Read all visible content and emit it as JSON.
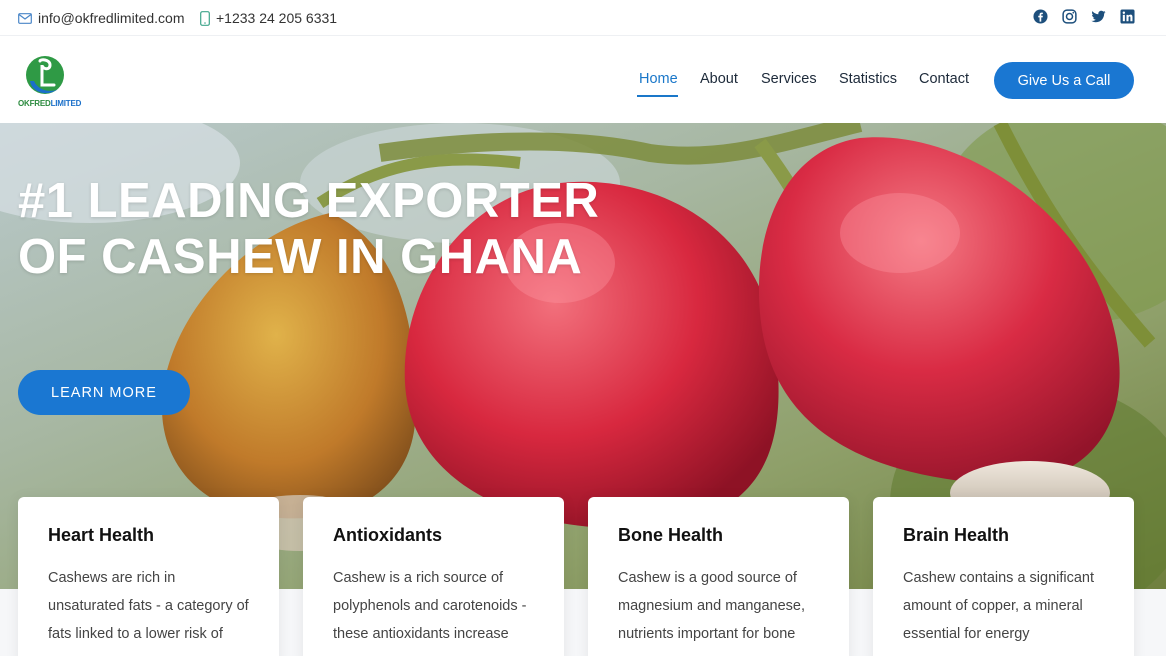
{
  "topbar": {
    "email": "info@okfredlimited.com",
    "phone": "+1233 24 205 6331",
    "socials": [
      "facebook-icon",
      "instagram-icon",
      "twitter-icon",
      "linkedin-icon"
    ]
  },
  "header": {
    "logo_text_a": "OKFRED",
    "logo_text_b": "LIMITED",
    "nav": [
      {
        "label": "Home",
        "active": true
      },
      {
        "label": "About"
      },
      {
        "label": "Services"
      },
      {
        "label": "Statistics"
      },
      {
        "label": "Contact"
      }
    ],
    "cta": "Give Us a Call"
  },
  "hero": {
    "title": "#1 Leading Exporter of Cashew in Ghana",
    "button": "LEARN MORE"
  },
  "cards": [
    {
      "title": "Heart Health",
      "text": "Cashews are rich in unsaturated fats - a category of fats linked to a lower risk of"
    },
    {
      "title": "Antioxidants",
      "text": "Cashew is a rich source of polyphenols and carotenoids - these antioxidants increase"
    },
    {
      "title": "Bone Health",
      "text": "Cashew is a good source of magnesium and manganese, nutrients important for bone"
    },
    {
      "title": "Brain Health",
      "text": "Cashew contains a significant amount of copper, a mineral essential for energy"
    }
  ],
  "colors": {
    "accent": "#1a77d2",
    "logo_green": "#2b8a3e"
  }
}
